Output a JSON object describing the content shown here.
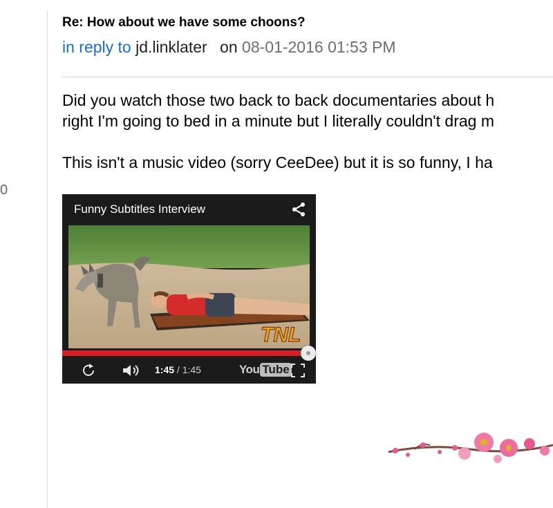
{
  "sidebar": {
    "count": "0"
  },
  "post": {
    "title": "Re: How about we have some choons?",
    "reply_prefix": "in reply to",
    "reply_user": "jd.linklater",
    "reply_on": "on",
    "reply_date": "08-01-2016 01:53 PM",
    "body_line1": "Did you watch those two back to back documentaries about h",
    "body_line2": "right I'm going to bed in a minute but I literally couldn't drag m",
    "body_line3": "This isn't a music video (sorry CeeDee) but it is so funny, I ha"
  },
  "video": {
    "title": "Funny Subtitles Interview",
    "watermark": "TNL",
    "time_current": "1:45",
    "time_sep": " / ",
    "time_total": "1:45",
    "progress": 1.0,
    "logo_you": "You",
    "logo_tube": "Tube",
    "icons": [
      "share-icon",
      "replay-icon",
      "volume-icon",
      "fullscreen-icon"
    ]
  },
  "colors": {
    "link": "#1a6fc4",
    "date": "#6d6d6d",
    "progress": "#d81f26",
    "player_bg": "#1b1b1b"
  }
}
